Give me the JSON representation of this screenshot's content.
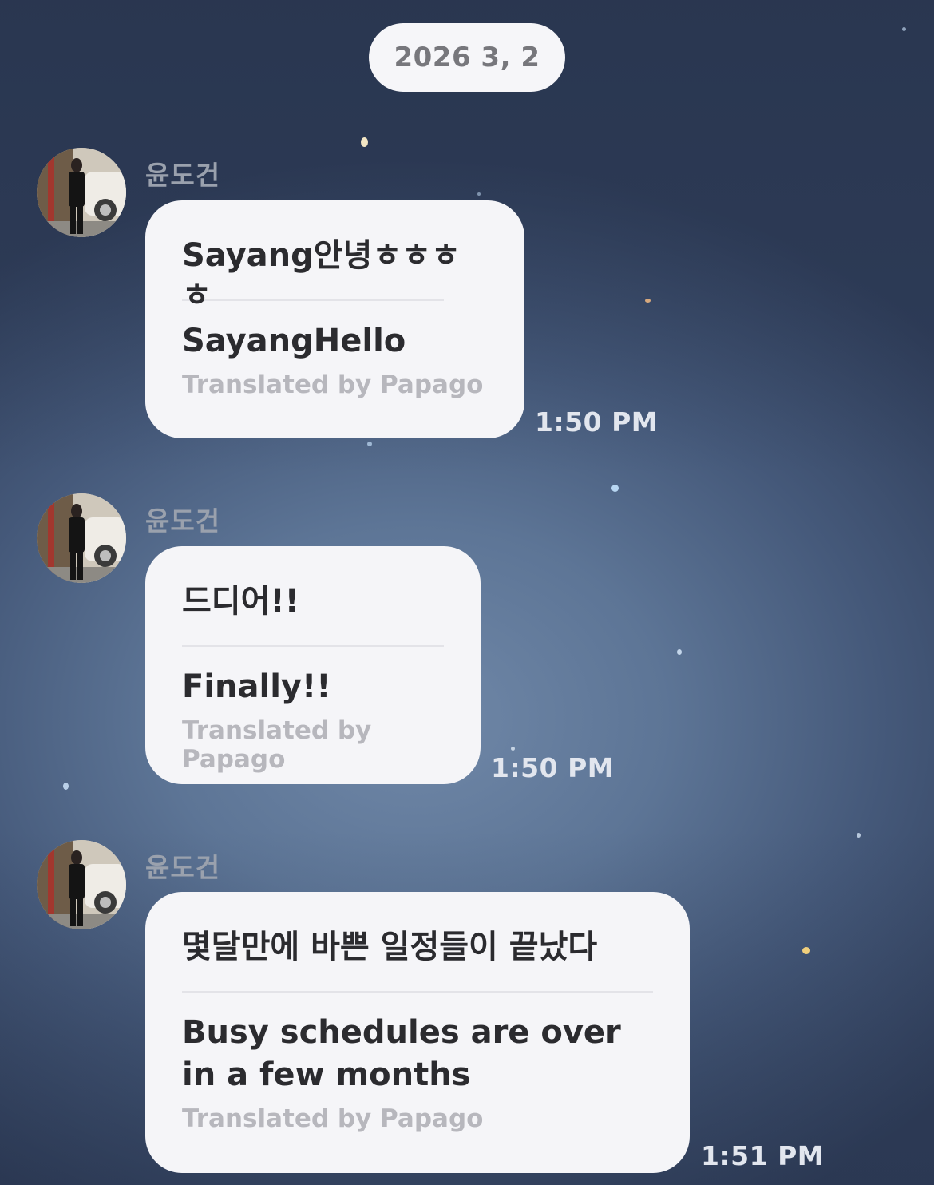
{
  "date_divider": "2026 3, 2",
  "messages": [
    {
      "sender": "윤도건",
      "original": "Sayang안녕ㅎㅎㅎㅎ",
      "translation": "SayangHello",
      "credit": "Translated by Papago",
      "time": "1:50 PM"
    },
    {
      "sender": "윤도건",
      "original": "드디어!!",
      "translation": "Finally!!",
      "credit": "Translated by Papago",
      "time": "1:50 PM"
    },
    {
      "sender": "윤도건",
      "original": "몇달만에 바쁜 일정들이 끝났다",
      "translation": "Busy schedules are over in a few months",
      "credit": "Translated by Papago",
      "time": "1:51 PM"
    }
  ],
  "icons": {
    "avatar": "profile-photo-avatar"
  }
}
